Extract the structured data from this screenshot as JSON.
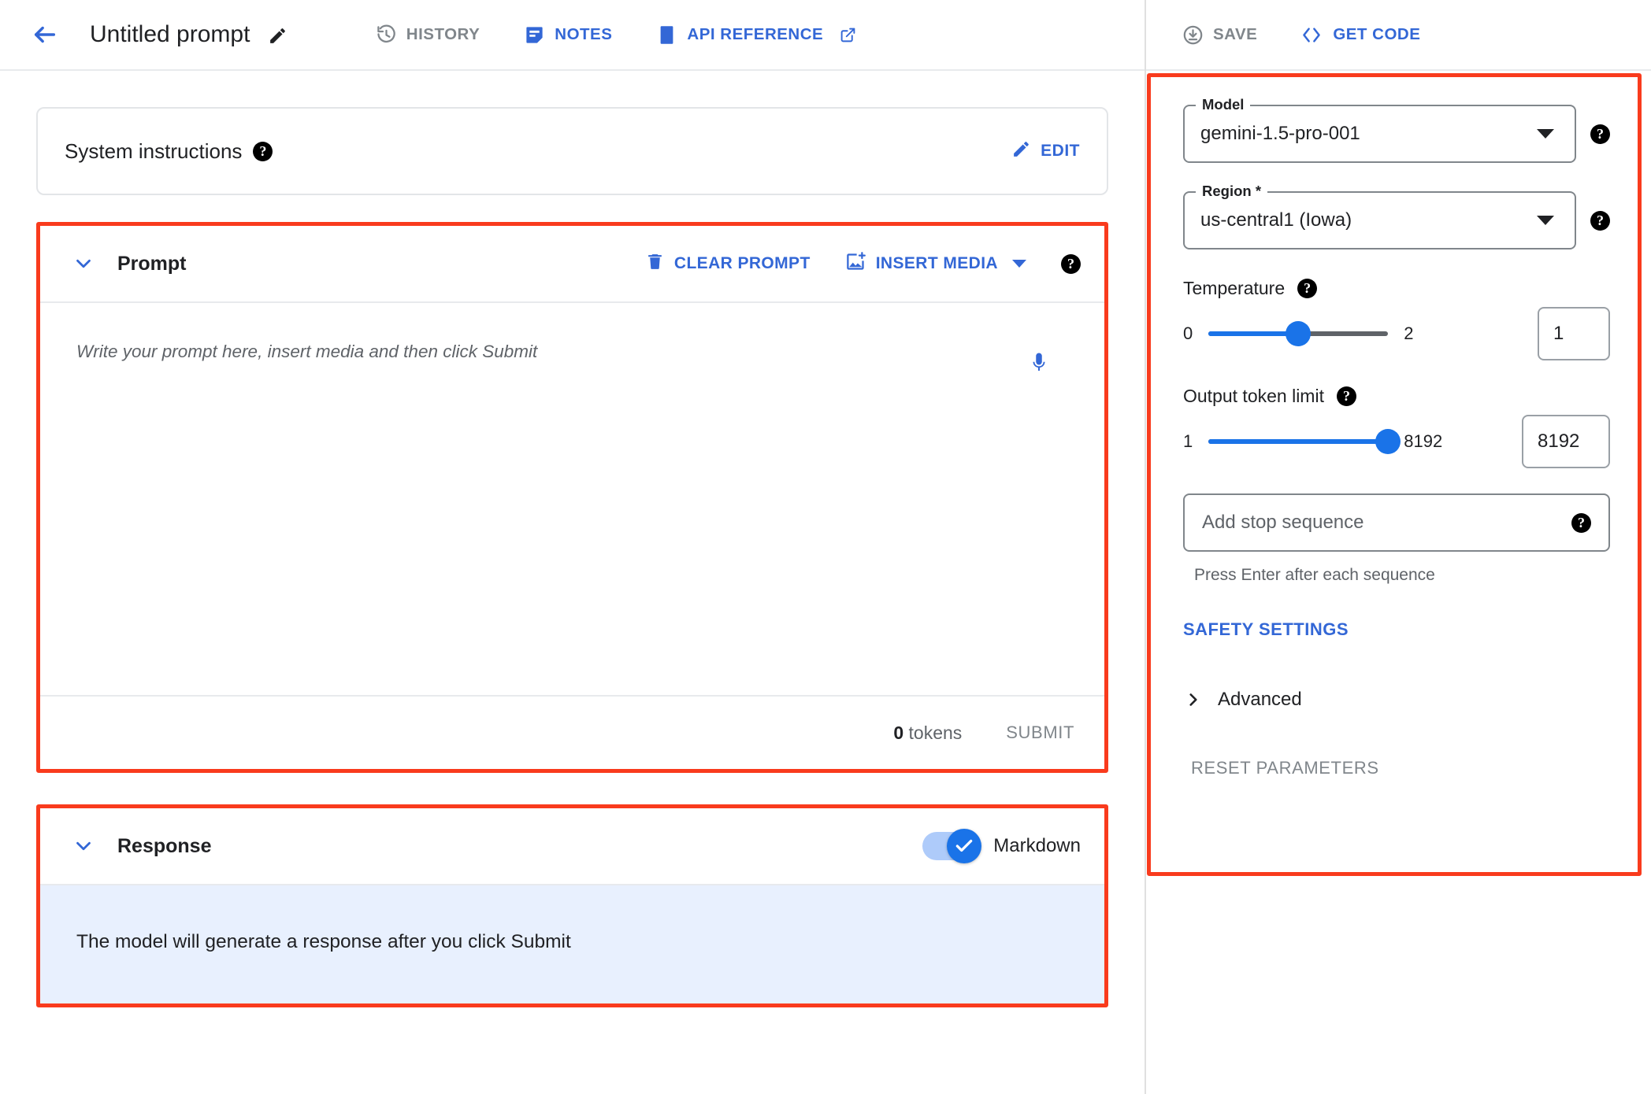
{
  "header": {
    "back_icon": "arrow-left-icon",
    "title": "Untitled prompt",
    "title_edit_icon": "pencil-icon",
    "history_label": "HISTORY",
    "history_icon": "history-clock-icon",
    "notes_label": "NOTES",
    "notes_icon": "notes-document-icon",
    "api_reference_label": "API REFERENCE",
    "api_reference_icon": "book-icon",
    "api_reference_external_icon": "open-in-new-icon",
    "save_label": "SAVE",
    "save_icon": "save-download-icon",
    "get_code_label": "GET CODE",
    "get_code_icon": "code-brackets-icon"
  },
  "system_instructions": {
    "title": "System instructions",
    "help_icon": "help-icon",
    "edit_label": "EDIT",
    "edit_icon": "pencil-icon"
  },
  "prompt": {
    "collapse_icon": "chevron-down-icon",
    "title": "Prompt",
    "clear_label": "CLEAR PROMPT",
    "clear_icon": "trash-icon",
    "insert_media_label": "INSERT MEDIA",
    "insert_media_icon": "add-image-icon",
    "insert_media_caret_icon": "caret-down-icon",
    "help_icon": "help-icon",
    "placeholder": "Write your prompt here, insert media and then click Submit",
    "value": "",
    "mic_icon": "microphone-icon",
    "token_count": "0",
    "token_unit": "tokens",
    "submit_label": "SUBMIT"
  },
  "response": {
    "collapse_icon": "chevron-down-icon",
    "title": "Response",
    "markdown_label": "Markdown",
    "markdown_on": true,
    "toggle_check_icon": "check-icon",
    "body_text": "The model will generate a response after you click Submit"
  },
  "parameters": {
    "model": {
      "label": "Model",
      "value": "gemini-1.5-pro-001",
      "caret_icon": "caret-down-icon",
      "help_icon": "help-icon"
    },
    "region": {
      "label": "Region *",
      "value": "us-central1 (Iowa)",
      "caret_icon": "caret-down-icon",
      "help_icon": "help-icon"
    },
    "temperature": {
      "label": "Temperature",
      "help_icon": "help-icon",
      "min": "0",
      "max": "2",
      "value": "1",
      "percent": 50
    },
    "output_token_limit": {
      "label": "Output token limit",
      "help_icon": "help-icon",
      "min": "1",
      "max": "8192",
      "value": "8192",
      "percent": 100
    },
    "stop_sequence": {
      "placeholder": "Add stop sequence",
      "value": "",
      "help_icon": "help-icon",
      "hint": "Press Enter after each sequence"
    },
    "safety_settings_label": "SAFETY SETTINGS",
    "advanced_label": "Advanced",
    "advanced_icon": "chevron-right-icon",
    "reset_label": "RESET PARAMETERS"
  },
  "colors": {
    "accent_blue": "#3367d6",
    "slider_blue": "#1a73e8",
    "annotation_red": "#f93b1d",
    "response_bg": "#e8f0fe",
    "muted_gray": "#80868b"
  }
}
